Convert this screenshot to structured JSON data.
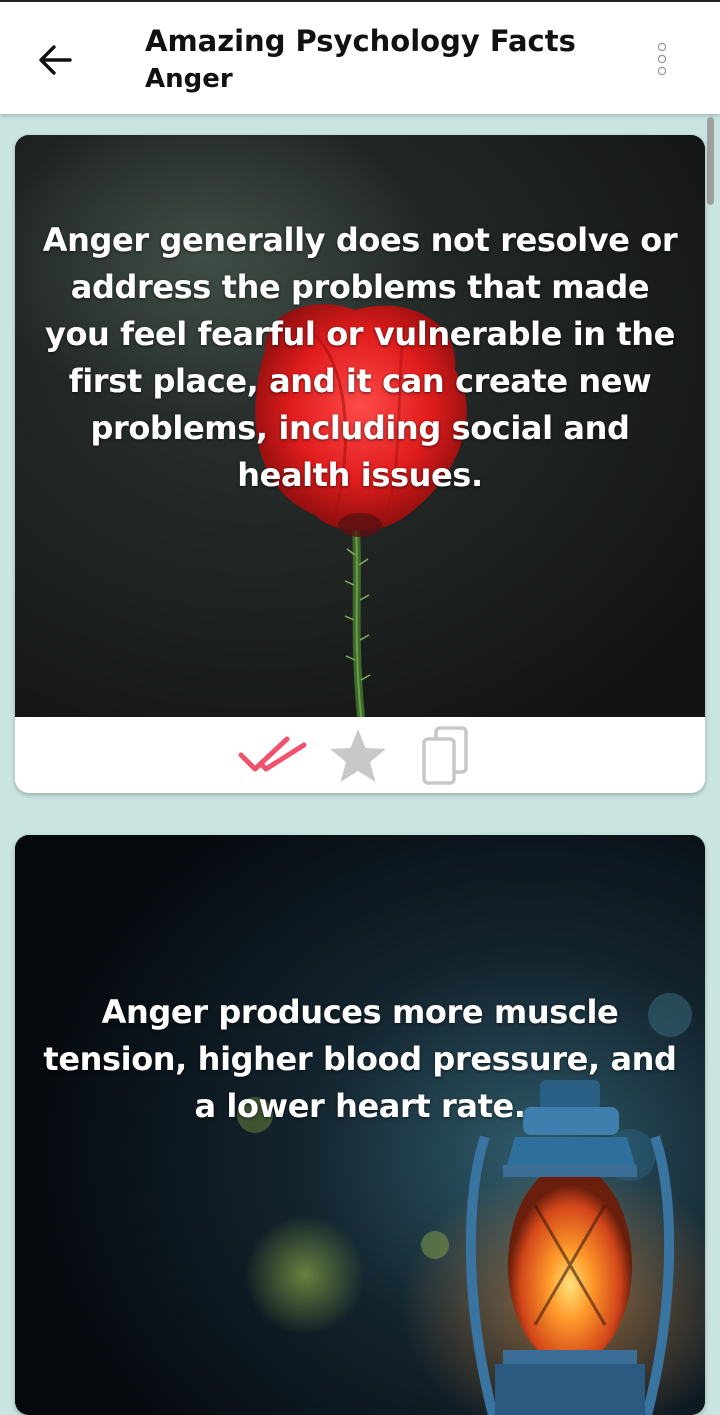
{
  "appbar": {
    "title": "Amazing Psychology Facts",
    "subtitle": "Anger",
    "back_icon": "arrow-left-icon",
    "menu_icon": "overflow-menu-icon"
  },
  "facts": [
    {
      "text": "Anger generally does not resolve or address the problems that made you feel fearful or vulnerable in the first place, and it can create new problems, including social and health issues.",
      "background": "red poppy flower on dark background",
      "actions": {
        "read_icon": "double-check-icon",
        "favorite_icon": "star-icon",
        "copy_icon": "copy-icon",
        "read": true,
        "favorite": false
      }
    },
    {
      "text": "Anger produces more muscle tension, higher blood pressure, and a lower heart rate.",
      "background": "glowing oil lantern at night"
    }
  ],
  "colors": {
    "page_background": "#c9e4e1",
    "read_accent": "#f0526e",
    "inactive_icon": "#c8c8c8"
  }
}
